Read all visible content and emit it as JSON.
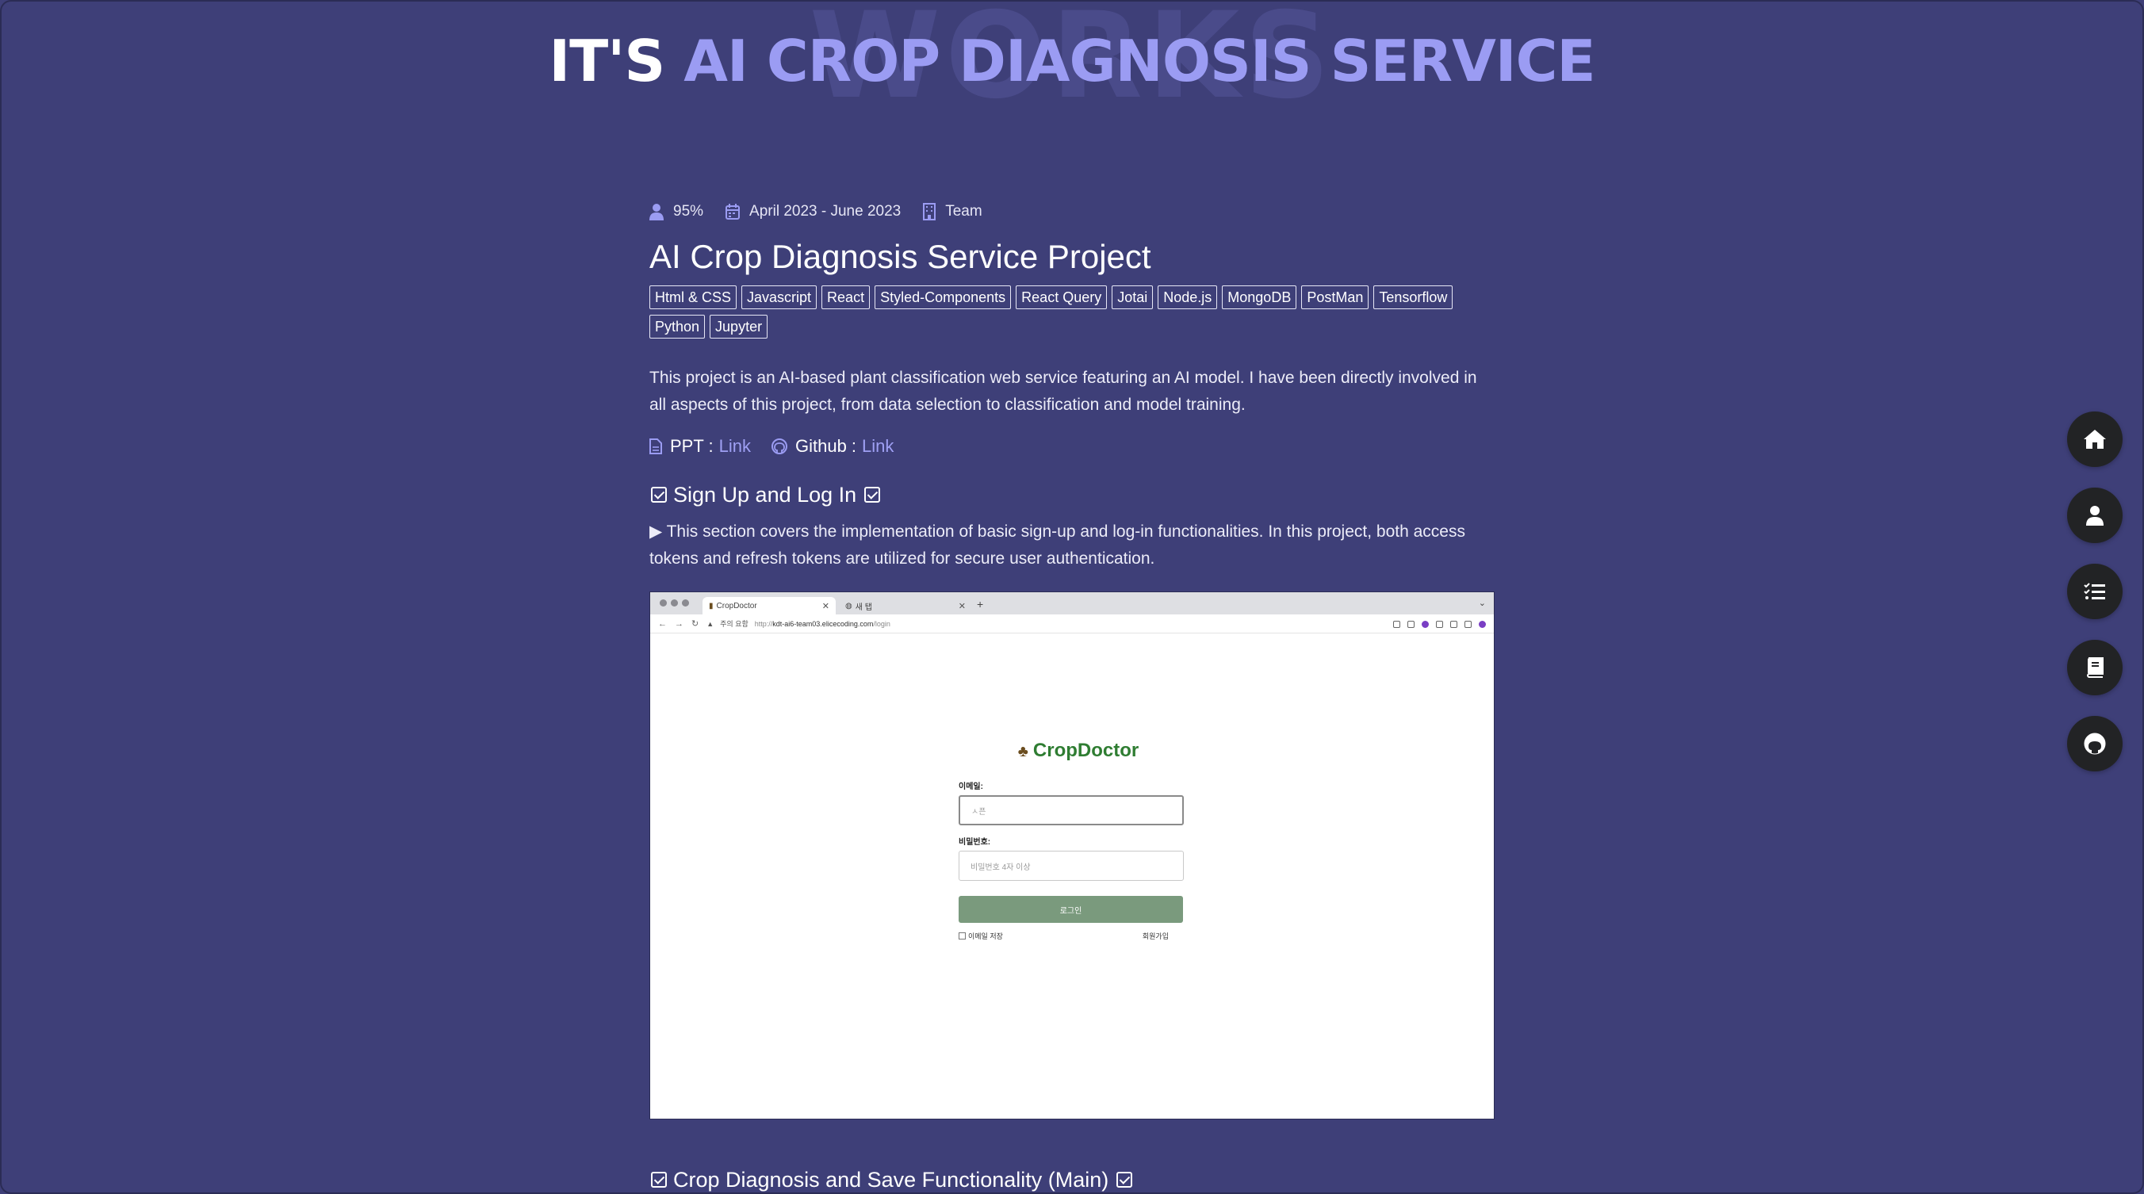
{
  "hero": {
    "watermark": "WORKS",
    "title_lead": "IT'S",
    "title_accent": "AI CROP DIAGNOSIS SERVICE"
  },
  "meta": {
    "contribution": "95%",
    "period": "April 2023 - June 2023",
    "team": "Team"
  },
  "project": {
    "title": "AI Crop Diagnosis Service Project",
    "tags": [
      "Html & CSS",
      "Javascript",
      "React",
      "Styled-Components",
      "React Query",
      "Jotai",
      "Node.js",
      "MongoDB",
      "PostMan",
      "Tensorflow",
      "Python",
      "Jupyter"
    ],
    "description": "This project is an AI-based plant classification web service featuring an AI model. I have been directly involved in all aspects of this project, from data selection to classification and model training."
  },
  "links": {
    "ppt_label": "PPT :",
    "ppt_link": "Link",
    "github_label": "Github :",
    "github_link": "Link"
  },
  "section1": {
    "heading": "Sign Up and Log In",
    "text": "▶ This section covers the implementation of basic sign-up and log-in functionalities. In this project, both access tokens and refresh tokens are utilized for secure user authentication."
  },
  "screenshot": {
    "tab1": "CropDoctor",
    "tab2": "새 탭",
    "new_tab": "+",
    "security_warning": "주의 요함",
    "url_scheme": "http://",
    "url_host": "kdt-ai6-team03.elicecoding.com",
    "url_path": "/login",
    "brand": "CropDoctor",
    "email_label": "이메일:",
    "email_value": "ㅅ픈",
    "password_label": "비밀번호:",
    "password_placeholder": "비밀번호 4자 이상",
    "login_button": "로그인",
    "remember_email": "이메일 저장",
    "signup_link": "회원가입"
  },
  "section2": {
    "heading": "Crop Diagnosis and Save Functionality (Main)"
  },
  "fab": [
    "home-icon",
    "user-icon",
    "list-check-icon",
    "book-icon",
    "github-icon"
  ],
  "colors": {
    "background": "#3e3f78",
    "accent": "#9b9cf3",
    "fab": "#222325",
    "brand_green": "#2f7d32"
  }
}
